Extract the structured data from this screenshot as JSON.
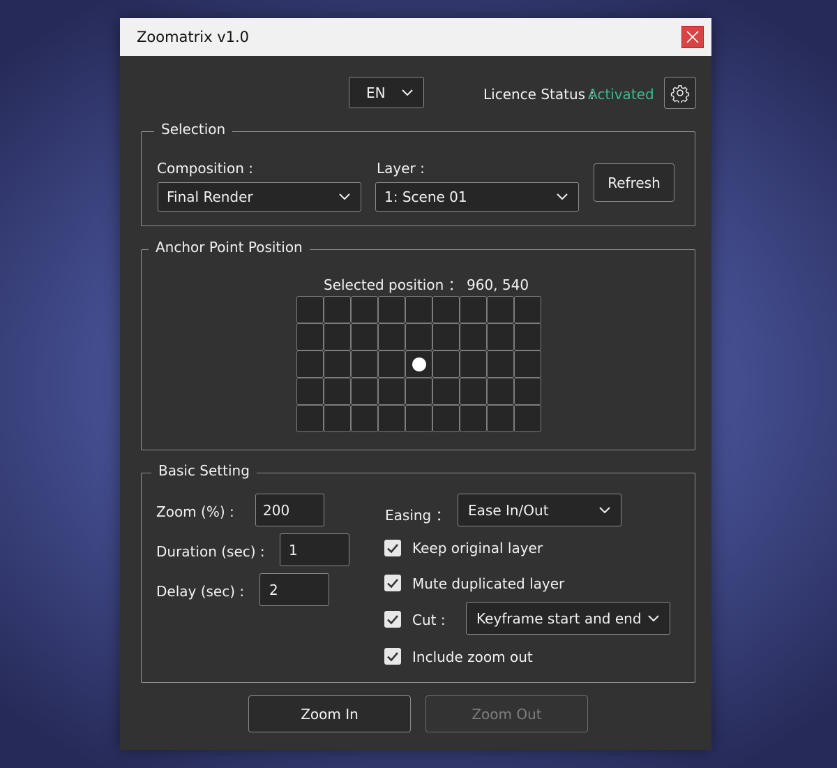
{
  "window": {
    "title": "Zoomatrix v1.0"
  },
  "header": {
    "language": "EN",
    "licence_label": "Licence Status :",
    "licence_value": "Activated",
    "licence_color": "#3db88a"
  },
  "selection": {
    "legend": "Selection",
    "composition_label": "Composition :",
    "composition_value": "Final Render",
    "layer_label": "Layer :",
    "layer_value": "1: Scene 01",
    "refresh_label": "Refresh"
  },
  "anchor": {
    "legend": "Anchor Point Position",
    "selected_text": "Selected position ： 960, 540",
    "grid_cols": 9,
    "grid_rows": 5,
    "selected_col": 4,
    "selected_row": 2
  },
  "basic": {
    "legend": "Basic Setting",
    "zoom_label": "Zoom (%) :",
    "zoom_value": "200",
    "duration_label": "Duration (sec) :",
    "duration_value": "1",
    "delay_label": "Delay (sec) :",
    "delay_value": "2",
    "easing_label": "Easing ：",
    "easing_value": "Ease In/Out",
    "keep_original_label": "Keep original layer",
    "keep_original_checked": true,
    "mute_duplicated_label": "Mute duplicated layer",
    "mute_duplicated_checked": true,
    "cut_label": "Cut :",
    "cut_checked": true,
    "cut_value": "Keyframe start and end",
    "include_zoom_out_label": "Include zoom out",
    "include_zoom_out_checked": true
  },
  "actions": {
    "zoom_in_label": "Zoom In",
    "zoom_out_label": "Zoom Out"
  }
}
